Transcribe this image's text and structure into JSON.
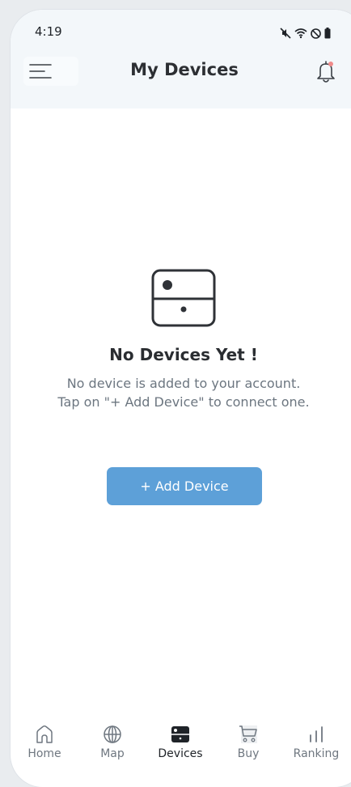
{
  "status_bar": {
    "time": "4:19",
    "icons": [
      "mute-icon",
      "wifi-icon",
      "do-not-disturb-icon",
      "battery-icon"
    ]
  },
  "header": {
    "title": "My Devices",
    "menu_icon": "hamburger-menu-icon",
    "notification_icon": "bell-icon",
    "notification_dot_color": "#f08b8b"
  },
  "empty_state": {
    "icon": "device-box-icon",
    "title": "No Devices Yet !",
    "description_line1": "No device is added to your account.",
    "description_line2": "Tap on \"+ Add Device\" to connect one."
  },
  "add_device_button": {
    "label": "+ Add Device",
    "color": "#5da0d8"
  },
  "bottom_nav": {
    "items": [
      {
        "label": "Home",
        "icon": "home-icon",
        "active": false
      },
      {
        "label": "Map",
        "icon": "globe-icon",
        "active": false
      },
      {
        "label": "Devices",
        "icon": "device-icon",
        "active": true
      },
      {
        "label": "Buy",
        "icon": "cart-icon",
        "active": false
      },
      {
        "label": "Ranking",
        "icon": "ranking-bars-icon",
        "active": false
      }
    ]
  }
}
